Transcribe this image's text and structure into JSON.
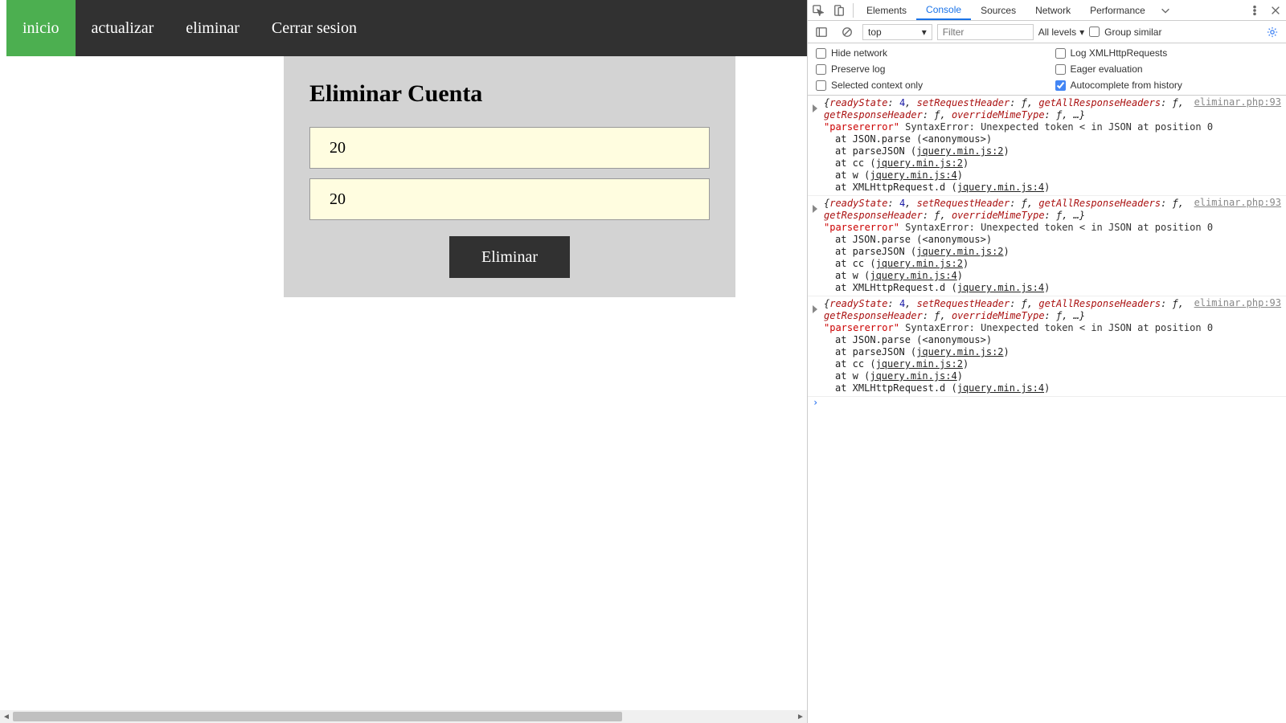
{
  "nav": {
    "items": [
      {
        "label": "inicio",
        "active": true
      },
      {
        "label": "actualizar",
        "active": false
      },
      {
        "label": "eliminar",
        "active": false
      },
      {
        "label": "Cerrar sesion",
        "active": false
      }
    ]
  },
  "card": {
    "title": "Eliminar Cuenta",
    "field1": "20",
    "field2": "20",
    "submit_label": "Eliminar"
  },
  "devtools": {
    "tabs": [
      {
        "label": "Elements",
        "active": false
      },
      {
        "label": "Console",
        "active": true
      },
      {
        "label": "Sources",
        "active": false
      },
      {
        "label": "Network",
        "active": false
      },
      {
        "label": "Performance",
        "active": false
      }
    ],
    "context": "top",
    "filter_placeholder": "Filter",
    "levels_label": "All levels",
    "group_similar_label": "Group similar",
    "checkboxes": {
      "hide_network": {
        "label": "Hide network",
        "checked": false
      },
      "log_xhr": {
        "label": "Log XMLHttpRequests",
        "checked": false
      },
      "preserve_log": {
        "label": "Preserve log",
        "checked": false
      },
      "eager_eval": {
        "label": "Eager evaluation",
        "checked": false
      },
      "selected_ctx": {
        "label": "Selected context only",
        "checked": false
      },
      "autocomplete_history": {
        "label": "Autocomplete from history",
        "checked": true
      }
    },
    "log_entries": [
      {
        "source": "eliminar.php:93",
        "ready_state": 4,
        "object_line": "{readyState: 4, setRequestHeader: ƒ, getAllResponseHeaders: ƒ, getResponseHeader: ƒ, overrideMimeType: ƒ, …}",
        "error_kw": "\"parsererror\"",
        "error_msg": " SyntaxError: Unexpected token < in JSON at position 0",
        "stack": [
          {
            "text": "at JSON.parse (<anonymous>)"
          },
          {
            "text": "at parseJSON (",
            "link": "jquery.min.js:2",
            "suffix": ")"
          },
          {
            "text": "at cc (",
            "link": "jquery.min.js:2",
            "suffix": ")"
          },
          {
            "text": "at w (",
            "link": "jquery.min.js:4",
            "suffix": ")"
          },
          {
            "text": "at XMLHttpRequest.d (",
            "link": "jquery.min.js:4",
            "suffix": ")"
          }
        ]
      },
      {
        "source": "eliminar.php:93",
        "ready_state": 4,
        "object_line": "{readyState: 4, setRequestHeader: ƒ, getAllResponseHeaders: ƒ, getResponseHeader: ƒ, overrideMimeType: ƒ, …}",
        "error_kw": "\"parsererror\"",
        "error_msg": " SyntaxError: Unexpected token < in JSON at position 0",
        "stack": [
          {
            "text": "at JSON.parse (<anonymous>)"
          },
          {
            "text": "at parseJSON (",
            "link": "jquery.min.js:2",
            "suffix": ")"
          },
          {
            "text": "at cc (",
            "link": "jquery.min.js:2",
            "suffix": ")"
          },
          {
            "text": "at w (",
            "link": "jquery.min.js:4",
            "suffix": ")"
          },
          {
            "text": "at XMLHttpRequest.d (",
            "link": "jquery.min.js:4",
            "suffix": ")"
          }
        ]
      },
      {
        "source": "eliminar.php:93",
        "ready_state": 4,
        "object_line": "{readyState: 4, setRequestHeader: ƒ, getAllResponseHeaders: ƒ, getResponseHeader: ƒ, overrideMimeType: ƒ, …}",
        "error_kw": "\"parsererror\"",
        "error_msg": " SyntaxError: Unexpected token < in JSON at position 0",
        "stack": [
          {
            "text": "at JSON.parse (<anonymous>)"
          },
          {
            "text": "at parseJSON (",
            "link": "jquery.min.js:2",
            "suffix": ")"
          },
          {
            "text": "at cc (",
            "link": "jquery.min.js:2",
            "suffix": ")"
          },
          {
            "text": "at w (",
            "link": "jquery.min.js:4",
            "suffix": ")"
          },
          {
            "text": "at XMLHttpRequest.d (",
            "link": "jquery.min.js:4",
            "suffix": ")"
          }
        ]
      }
    ]
  }
}
